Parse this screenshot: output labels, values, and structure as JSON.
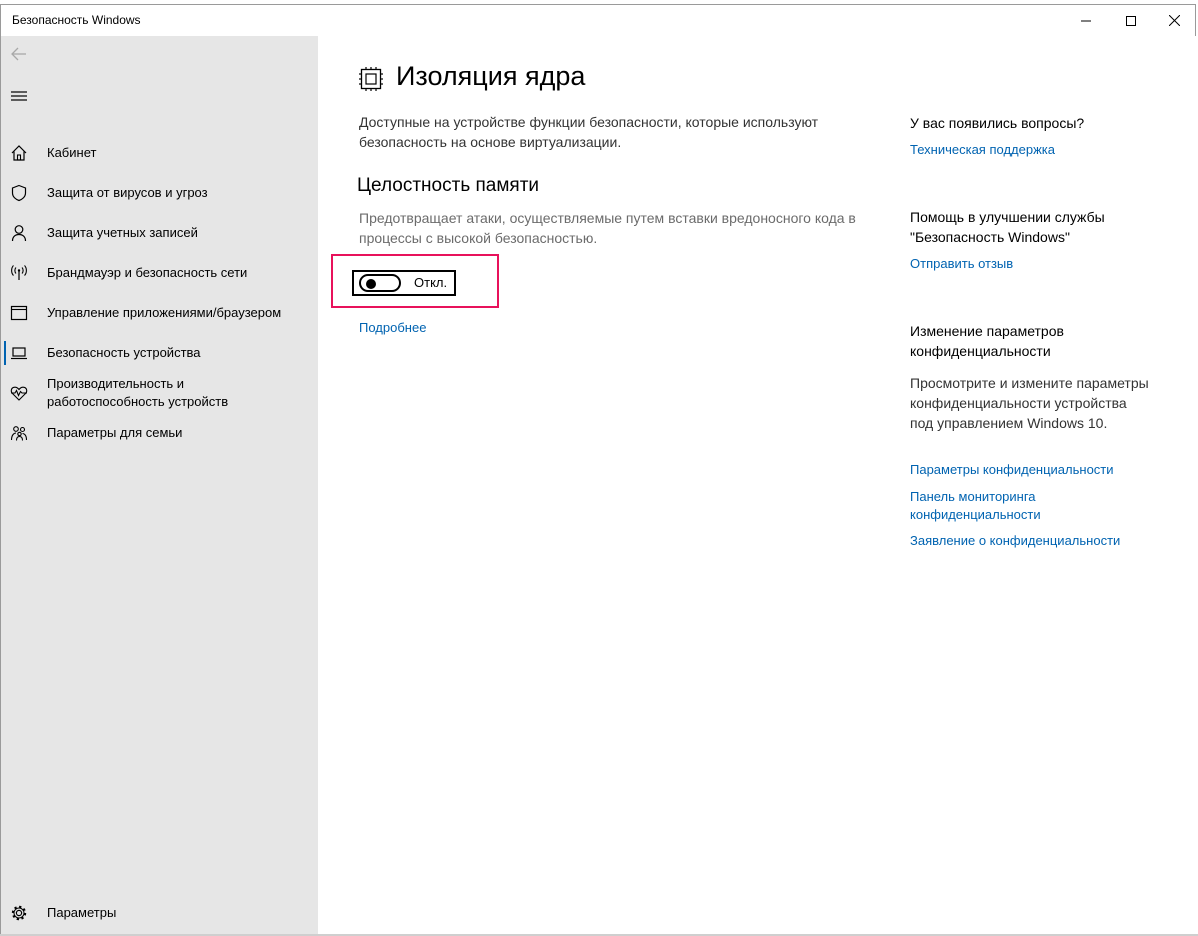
{
  "window": {
    "title": "Безопасность Windows"
  },
  "sidebar": {
    "items": [
      {
        "label": "Кабинет",
        "icon": "home-icon"
      },
      {
        "label": "Защита от вирусов и угроз",
        "icon": "shield-icon"
      },
      {
        "label": "Защита учетных записей",
        "icon": "person-icon"
      },
      {
        "label": "Брандмауэр и безопасность сети",
        "icon": "wifi-antenna-icon"
      },
      {
        "label": "Управление приложениями/браузером",
        "icon": "app-window-icon"
      },
      {
        "label": "Безопасность устройства",
        "icon": "laptop-icon",
        "active": true
      },
      {
        "label": "Производительность и работоспособность устройств",
        "icon": "heart-pulse-icon"
      },
      {
        "label": "Параметры для семьи",
        "icon": "family-icon"
      }
    ],
    "settings_label": "Параметры"
  },
  "main": {
    "page_icon": "core-isolation-chip-icon",
    "title": "Изоляция ядра",
    "description": "Доступные на устройстве функции безопасности, которые используют безопасность на основе виртуализации.",
    "section": {
      "title": "Целостность памяти",
      "description": "Предотвращает атаки, осуществляемые путем вставки вредоносного кода в процессы с высокой безопасностью.",
      "toggle_state": "Откл.",
      "toggle_on": false,
      "more_link": "Подробнее"
    },
    "highlight_color": "#e8115b"
  },
  "aside": {
    "questions_title": "У вас появились вопросы?",
    "support_link": "Техническая поддержка",
    "improve_title": "Помощь в улучшении службы \"Безопасность Windows\"",
    "feedback_link": "Отправить отзыв",
    "privacy_title": "Изменение параметров конфиденциальности",
    "privacy_text": "Просмотрите и измените параметры конфиденциальности устройства под управлением Windows 10.",
    "privacy_links": [
      "Параметры конфиденциальности",
      "Панель мониторинга конфиденциальности",
      "Заявление о конфиденциальности"
    ]
  },
  "colors": {
    "accent": "#0063b1",
    "sidebar_bg": "#e6e6e6"
  }
}
